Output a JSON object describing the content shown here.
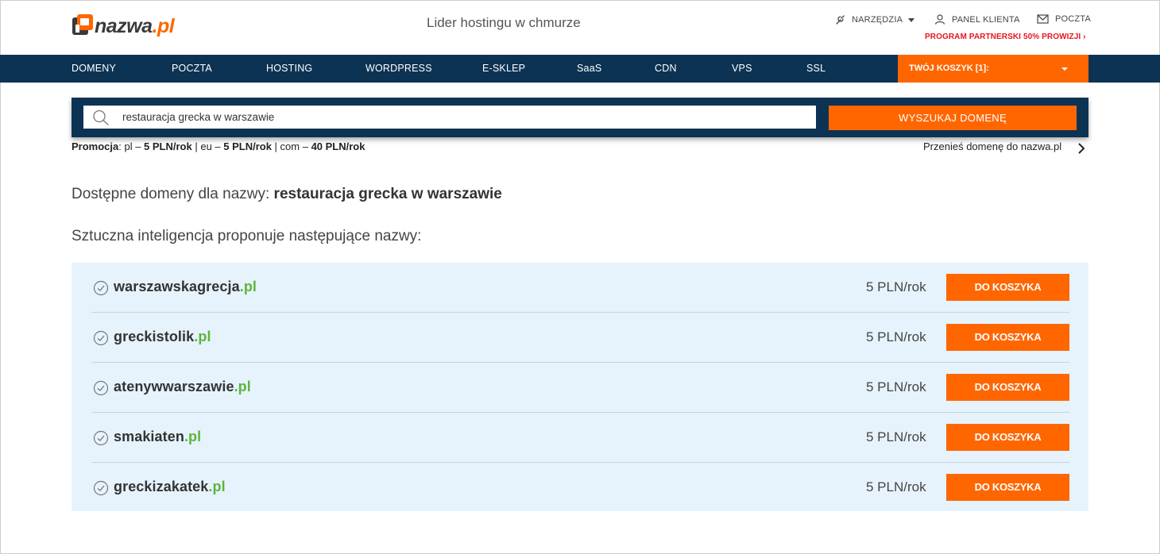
{
  "header": {
    "logo_text_main": "nazwa",
    "logo_text_tld": ".pl",
    "tagline": "Lider hostingu w chmurze",
    "tools_label": "NARZĘDZIA",
    "panel_label": "PANEL KLIENTA",
    "mail_label": "POCZTA",
    "partner_label": "PROGRAM PARTNERSKI 50% PROWIZJI ›"
  },
  "nav": {
    "items": [
      {
        "label": "DOMENY"
      },
      {
        "label": "POCZTA"
      },
      {
        "label": "HOSTING"
      },
      {
        "label": "WORDPRESS"
      },
      {
        "label": "E-SKLEP"
      },
      {
        "label": "SaaS"
      },
      {
        "label": "CDN"
      },
      {
        "label": "VPS"
      },
      {
        "label": "SSL"
      }
    ],
    "cart_label": "TWÓJ KOSZYK [1]:"
  },
  "search": {
    "value": "restauracja grecka w warszawie",
    "button_label": "WYSZUKAJ DOMENĘ"
  },
  "promo": {
    "label": "Promocja",
    "pl_prefix": ": pl – ",
    "pl_price": "5 PLN/rok",
    "eu_prefix": " | eu – ",
    "eu_price": "5 PLN/rok",
    "com_prefix": " | com – ",
    "com_price": "40 PLN/rok"
  },
  "transfer_link": "Przenieś domenę do nazwa.pl",
  "available": {
    "prefix": "Dostępne domeny dla nazwy: ",
    "query": "restauracja grecka w warszawie"
  },
  "ai_label": "Sztuczna inteligencja proponuje następujące nazwy:",
  "results": [
    {
      "name": "warszawskagrecja",
      "tld": ".pl",
      "price": "5 PLN/rok",
      "button": "DO KOSZYKA"
    },
    {
      "name": "greckistolik",
      "tld": ".pl",
      "price": "5 PLN/rok",
      "button": "DO KOSZYKA"
    },
    {
      "name": "atenywwarszawie",
      "tld": ".pl",
      "price": "5 PLN/rok",
      "button": "DO KOSZYKA"
    },
    {
      "name": "smakiaten",
      "tld": ".pl",
      "price": "5 PLN/rok",
      "button": "DO KOSZYKA"
    },
    {
      "name": "greckizakatek",
      "tld": ".pl",
      "price": "5 PLN/rok",
      "button": "DO KOSZYKA"
    }
  ],
  "colors": {
    "brand_orange": "#ff6600",
    "nav_navy": "#0c3354",
    "results_bg": "#e6f3fc",
    "tld_green": "#5cb53a",
    "partner_red": "#e8141e"
  },
  "icons": [
    "logo-mark-icon",
    "wrench-icon",
    "user-icon",
    "envelope-icon",
    "search-icon",
    "chevron-right-icon",
    "check-circle-icon",
    "caret-down-icon"
  ]
}
